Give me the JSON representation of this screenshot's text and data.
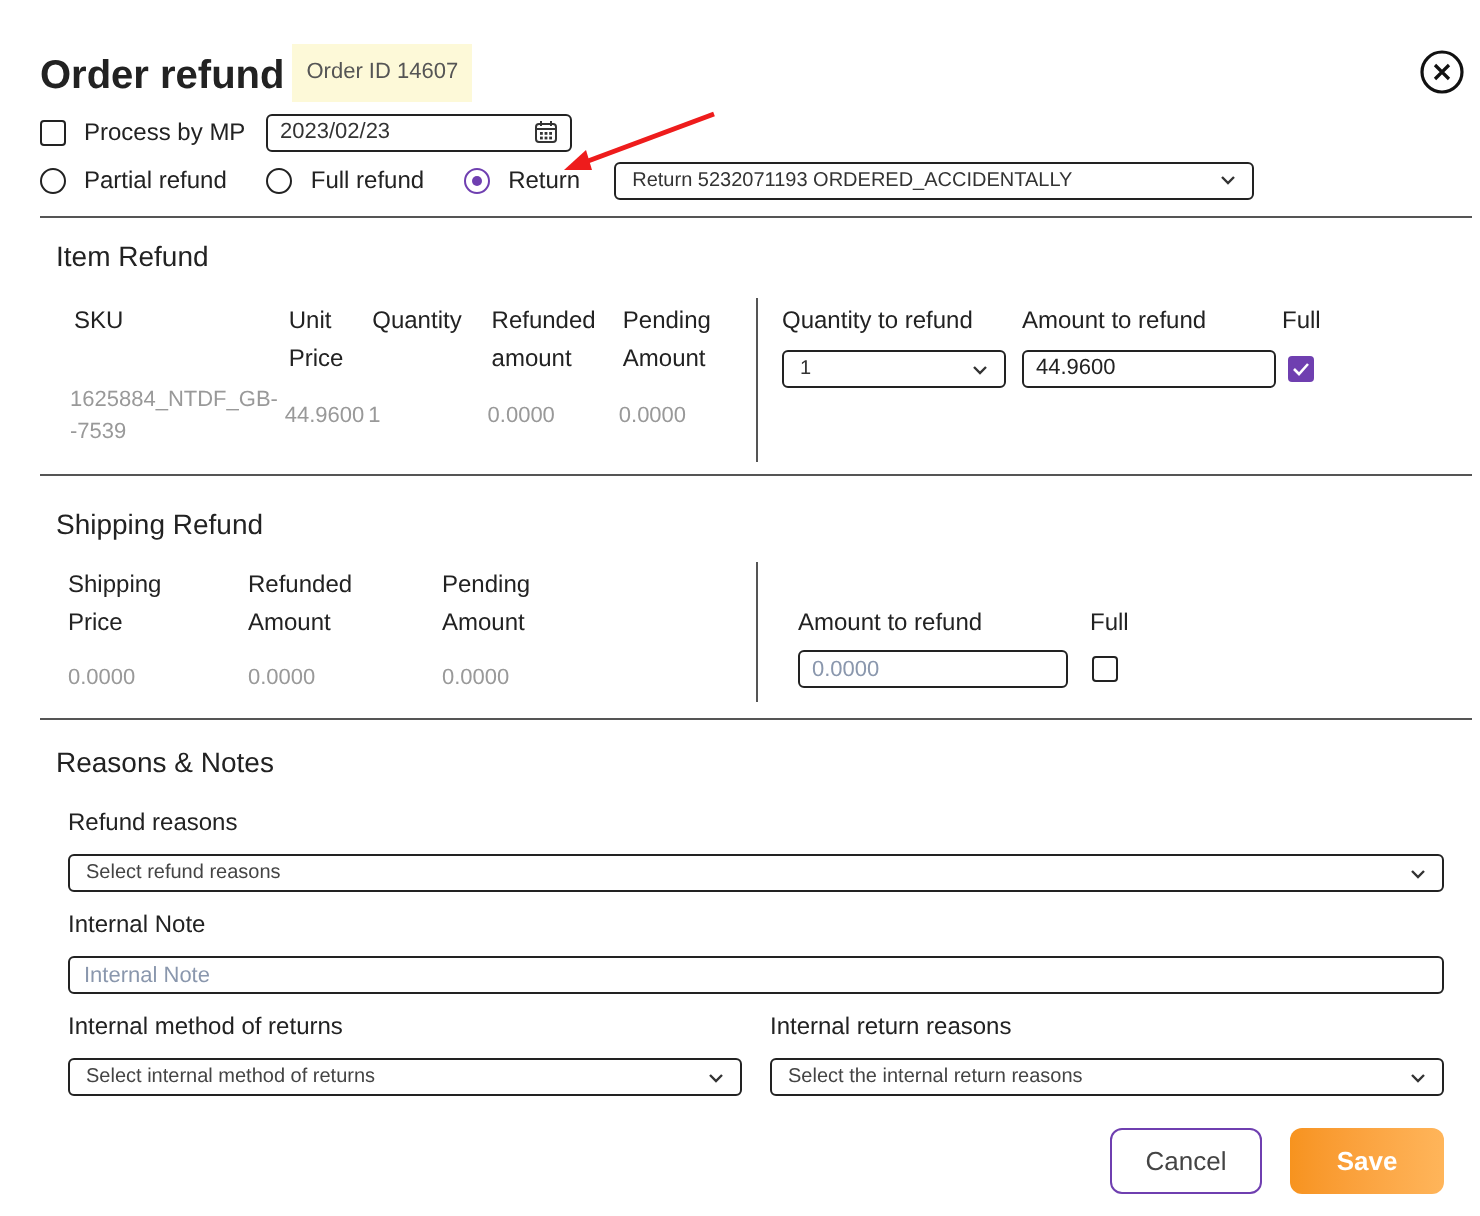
{
  "dialog": {
    "title": "Order refund",
    "order_badge": "Order ID 14607"
  },
  "process_by_mp": {
    "label": "Process by MP",
    "checked": false
  },
  "date_field": {
    "value": "2023/02/23"
  },
  "refund_types": [
    {
      "label": "Partial refund",
      "selected": false
    },
    {
      "label": "Full refund",
      "selected": false
    },
    {
      "label": "Return",
      "selected": true
    }
  ],
  "return_select": {
    "value": "Return 5232071193 ORDERED_ACCIDENTALLY"
  },
  "item_refund": {
    "title": "Item Refund",
    "columns": [
      "SKU",
      "Unit Price",
      "Quantity",
      "Refunded amount",
      "Pending Amount"
    ],
    "refund_columns": [
      "Quantity to refund",
      "Amount to refund",
      "Full"
    ],
    "rows": [
      {
        "cells": [
          "1625884_NTDF_GB--7539",
          "44.9600",
          "1",
          "0.0000",
          "0.0000"
        ],
        "quantity_to_refund": "1",
        "amount_to_refund": "44.9600",
        "full": true
      }
    ]
  },
  "shipping_refund": {
    "title": "Shipping Refund",
    "columns": [
      "Shipping Price",
      "Refunded Amount",
      "Pending Amount"
    ],
    "values": [
      "0.0000",
      "0.0000",
      "0.0000"
    ],
    "refund_columns": [
      "Amount to refund",
      "Full"
    ],
    "amount_placeholder": "0.0000",
    "full": false
  },
  "reasons_notes": {
    "title": "Reasons & Notes",
    "refund_reasons": {
      "label": "Refund reasons",
      "placeholder": "Select refund reasons"
    },
    "internal_note": {
      "label": "Internal Note",
      "placeholder": "Internal Note"
    },
    "internal_method": {
      "label": "Internal method of returns",
      "placeholder": "Select internal method of returns"
    },
    "internal_return_reasons": {
      "label": "Internal return reasons",
      "placeholder": "Select the internal return reasons"
    }
  },
  "buttons": [
    {
      "label": "Cancel",
      "kind": "secondary"
    },
    {
      "label": "Save",
      "kind": "primary"
    }
  ]
}
